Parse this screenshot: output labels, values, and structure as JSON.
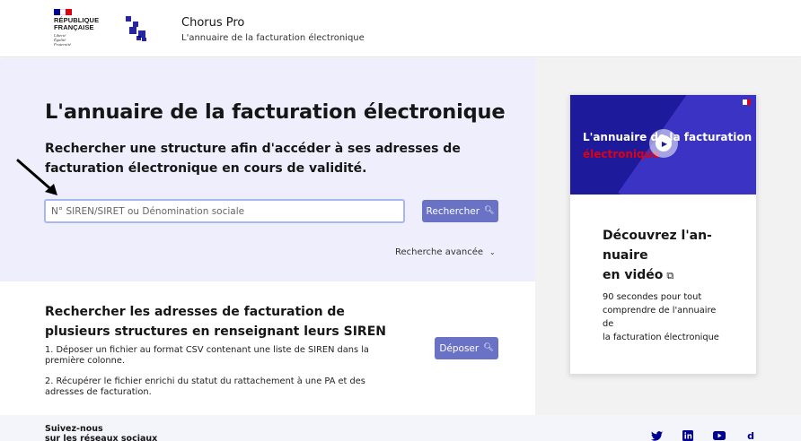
{
  "header": {
    "gov_title": "RÉPUBLIQUE\nFRANÇAISE",
    "gov_motto": "Liberté\nÉgalité\nFraternité",
    "brand_title": "Chorus Pro",
    "brand_subtitle": "L'annuaire de la facturation électronique"
  },
  "hero": {
    "title": "L'annuaire de la facturation électronique",
    "subtitle": "Rechercher une structure afin d'accéder à ses adresses de facturation électronique en cours de validité.",
    "search_placeholder": "N° SIREN/SIRET ou Dénomination sociale",
    "search_value": "",
    "search_button": "Rechercher",
    "advanced_search": "Recherche avancée"
  },
  "bulk": {
    "title": "Rechercher les adresses de facturation de plusieurs structures en renseignant leurs SIREN",
    "step1": "1. Déposer un fichier au format CSV contenant une liste de SIREN dans la première colonne.",
    "step2": "2. Récupérer le fichier enrichi du statut du rattachement à une PA et des adresses de facturation.",
    "deposit_button": "Déposer"
  },
  "video_card": {
    "thumb_line1": "L'annuaire de la facturation",
    "thumb_line2": "électronique",
    "title": "Découvrez l'an-\nnuaire\nen vidéo",
    "text": "90 secondes pour tout\ncomprendre de l'annuaire\nde\nla facturation électronique"
  },
  "footer": {
    "follow": "Suivez-nous\nsur les réseaux sociaux",
    "social": {
      "twitter": "twitter-icon",
      "linkedin": "linkedin-icon",
      "youtube": "youtube-icon",
      "dailymotion": "d"
    }
  },
  "colors": {
    "accent": "#000091",
    "button": "#6a72c6",
    "hero_bg": "#eeeefc",
    "marianne_red": "#e1000f"
  }
}
